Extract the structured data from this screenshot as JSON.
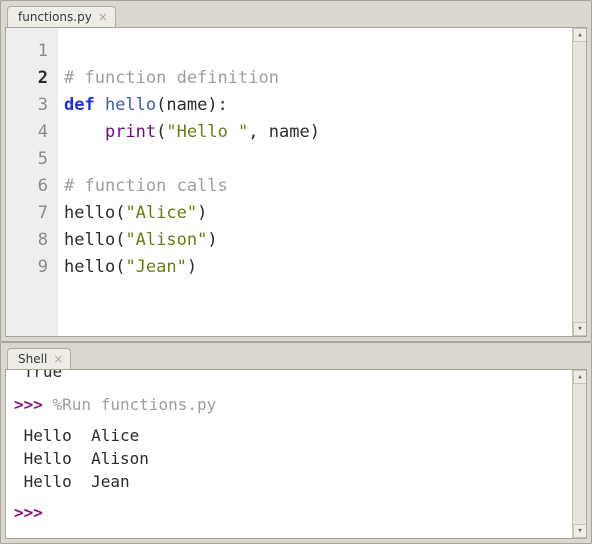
{
  "editor": {
    "tab_label": "functions.py",
    "tab_close_glyph": "×",
    "active_line": 2,
    "code_lines": [
      {
        "n": 1,
        "tokens": []
      },
      {
        "n": 2,
        "tokens": [
          {
            "t": "# function definition",
            "c": "comment"
          }
        ]
      },
      {
        "n": 3,
        "tokens": [
          {
            "t": "def ",
            "c": "kw"
          },
          {
            "t": "hello",
            "c": "func"
          },
          {
            "t": "(name):",
            "c": "paren"
          }
        ]
      },
      {
        "n": 4,
        "tokens": [
          {
            "t": "    ",
            "c": ""
          },
          {
            "t": "print",
            "c": "builtin"
          },
          {
            "t": "(",
            "c": "paren"
          },
          {
            "t": "\"Hello \"",
            "c": "str"
          },
          {
            "t": ", name)",
            "c": "paren"
          }
        ]
      },
      {
        "n": 5,
        "tokens": []
      },
      {
        "n": 6,
        "tokens": [
          {
            "t": "# function calls",
            "c": "comment"
          }
        ]
      },
      {
        "n": 7,
        "tokens": [
          {
            "t": "hello",
            "c": ""
          },
          {
            "t": "(",
            "c": "paren"
          },
          {
            "t": "\"Alice\"",
            "c": "str"
          },
          {
            "t": ")",
            "c": "paren"
          }
        ]
      },
      {
        "n": 8,
        "tokens": [
          {
            "t": "hello",
            "c": ""
          },
          {
            "t": "(",
            "c": "paren"
          },
          {
            "t": "\"Alison\"",
            "c": "str"
          },
          {
            "t": ")",
            "c": "paren"
          }
        ]
      },
      {
        "n": 9,
        "tokens": [
          {
            "t": "hello",
            "c": ""
          },
          {
            "t": "(",
            "c": "paren"
          },
          {
            "t": "\"Jean\"",
            "c": "str"
          },
          {
            "t": ")",
            "c": "paren"
          }
        ]
      }
    ]
  },
  "shell": {
    "tab_label": "Shell",
    "tab_close_glyph": "×",
    "lines": [
      {
        "type": "clip",
        "text": " True"
      },
      {
        "type": "blank"
      },
      {
        "type": "cmd",
        "prompt": ">>> ",
        "magic": "%Run functions.py"
      },
      {
        "type": "blank-half"
      },
      {
        "type": "out",
        "text": " Hello  Alice"
      },
      {
        "type": "out",
        "text": " Hello  Alison"
      },
      {
        "type": "out",
        "text": " Hello  Jean"
      },
      {
        "type": "blank-half"
      },
      {
        "type": "prompt-only",
        "prompt": ">>> "
      }
    ]
  },
  "scrollbar": {
    "up_glyph": "▴",
    "down_glyph": "▾"
  }
}
